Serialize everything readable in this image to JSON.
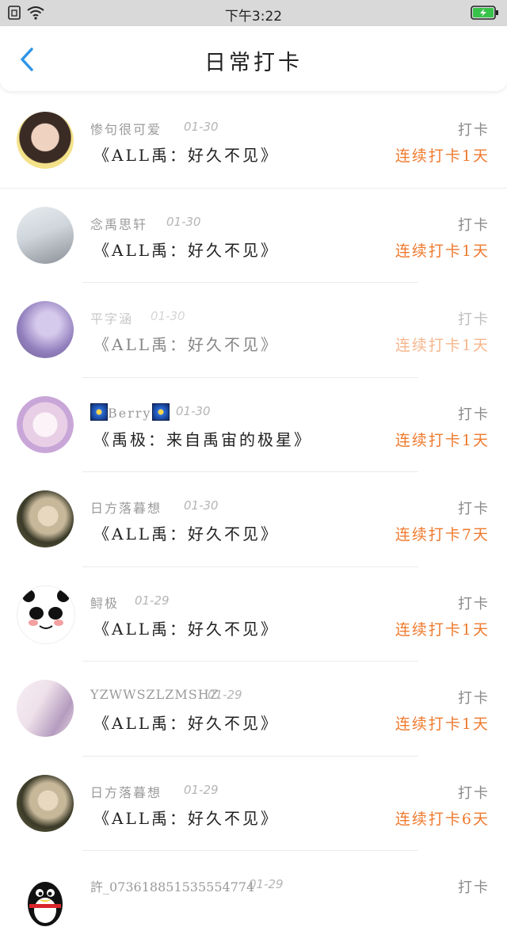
{
  "status_bar": {
    "time": "下午3:22"
  },
  "header": {
    "title": "日常打卡"
  },
  "items": [
    {
      "name": "惨句很可爱",
      "date": "01-30",
      "book": "《ALL禹：好久不见》",
      "action": "打卡",
      "streak": "连续打卡1天",
      "avatar_colors": [
        "#3b2b25",
        "#f0d2c0"
      ]
    },
    {
      "name": "念禹思轩",
      "date": "01-30",
      "book": "《ALL禹：好久不见》",
      "action": "打卡",
      "streak": "连续打卡1天",
      "avatar_colors": [
        "#cfd6dc",
        "#8a8f96"
      ]
    },
    {
      "name": "平字涵",
      "date": "01-30",
      "book": "《ALL禹：好久不见》",
      "action": "打卡",
      "streak": "连续打卡1天",
      "avatar_colors": [
        "#6e55a8",
        "#c7b8e6"
      ]
    },
    {
      "name": "Berry",
      "date": "01-30",
      "book": "《禹极：来自禹宙的极星》",
      "action": "打卡",
      "streak": "连续打卡1天",
      "avatar_colors": [
        "#f3e8f3",
        "#c9a6d8"
      ]
    },
    {
      "name": "日方落暮想",
      "date": "01-30",
      "book": "《ALL禹：好久不见》",
      "action": "打卡",
      "streak": "连续打卡7天",
      "avatar_colors": [
        "#3a3a28",
        "#c8b89a"
      ]
    },
    {
      "name": "鲟极",
      "date": "01-29",
      "book": "《ALL禹：好久不见》",
      "action": "打卡",
      "streak": "连续打卡1天",
      "avatar_colors": [
        "#ffffff",
        "#e8a0a0"
      ]
    },
    {
      "name": "YZWWSZLZMSHZ",
      "date": "01-29",
      "book": "《ALL禹：好久不见》",
      "action": "打卡",
      "streak": "连续打卡1天",
      "avatar_colors": [
        "#efe1ea",
        "#b49cbf"
      ]
    },
    {
      "name": "日方落暮想",
      "date": "01-29",
      "book": "《ALL禹：好久不见》",
      "action": "打卡",
      "streak": "连续打卡6天",
      "avatar_colors": [
        "#3a3a28",
        "#c8b89a"
      ]
    },
    {
      "name": "許_073618851535554774",
      "date": "01-29",
      "book": "",
      "action": "打卡",
      "streak": "",
      "avatar_colors": [
        "#111111",
        "#f5c200"
      ]
    }
  ],
  "colors": {
    "accent": "#ef7a2e",
    "back": "#2f95e8"
  }
}
